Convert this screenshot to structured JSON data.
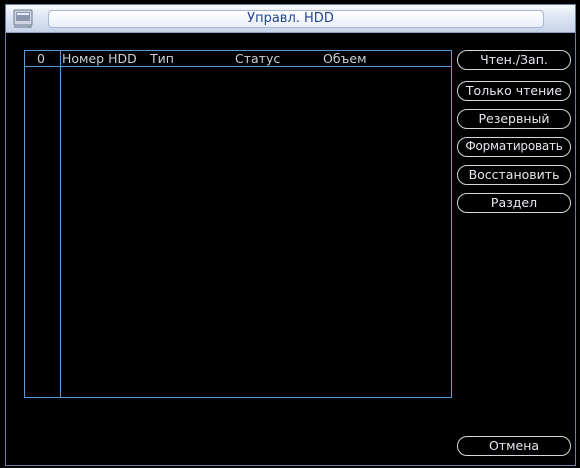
{
  "window": {
    "title": "Управл. HDD"
  },
  "table": {
    "columns": {
      "index": "0",
      "hdd_number": "Номер HDD",
      "type": "Тип",
      "status": "Статус",
      "capacity": "Объем"
    },
    "rows": []
  },
  "actions": {
    "read_write": "Чтен./Зап.",
    "read_only": "Только чтение",
    "redundant": "Резервный",
    "format": "Форматировать",
    "restore": "Восстановить",
    "partition": "Раздел"
  },
  "footer": {
    "cancel": "Отмена"
  },
  "colors": {
    "title_text": "#24458f",
    "list_border": "#5a9ad6",
    "button_border": "#d2d7e0",
    "background": "#000000"
  },
  "icons": {
    "app": "hdd-manager-icon"
  }
}
